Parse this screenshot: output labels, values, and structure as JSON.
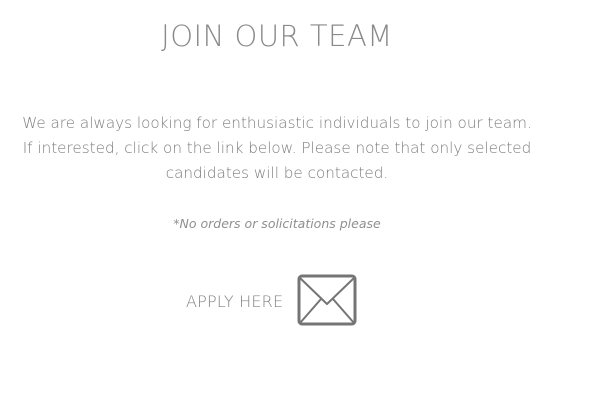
{
  "heading": "JOIN OUR TEAM",
  "intro": {
    "line1": "We are always looking for enthusiastic individuals to join our team.",
    "line2": "If interested, click on the link below. Please note that only selected",
    "line3": "candidates will be contacted."
  },
  "note": "*No orders or solicitations please",
  "apply": {
    "label": "APPLY HERE",
    "icon": "envelope-icon"
  },
  "colors": {
    "text": "#7d7d7d",
    "icon": "#757575",
    "background": "#ffffff"
  }
}
